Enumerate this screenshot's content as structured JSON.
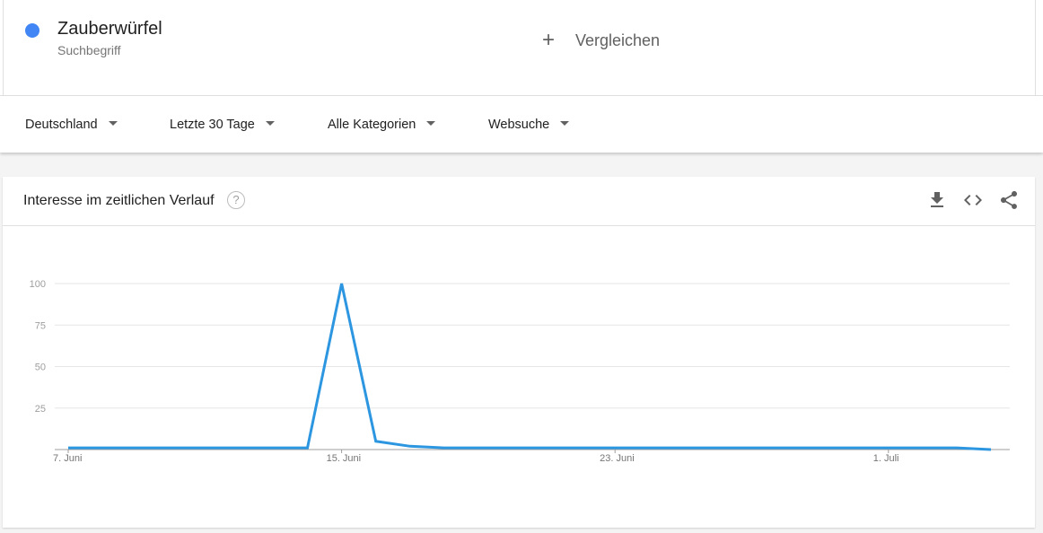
{
  "term": {
    "name": "Zauberwürfel",
    "type": "Suchbegriff",
    "color": "#4285f4"
  },
  "compare": {
    "plus": "+",
    "label": "Vergleichen"
  },
  "filters": {
    "region": "Deutschland",
    "time": "Letzte 30 Tage",
    "category": "Alle Kategorien",
    "search_type": "Websuche"
  },
  "card": {
    "title": "Interesse im zeitlichen Verlauf",
    "help": "?",
    "icons": [
      "download-icon",
      "embed-icon",
      "share-icon"
    ]
  },
  "chart_data": {
    "type": "line",
    "x": [
      "7. Juni",
      "8. Juni",
      "9. Juni",
      "10. Juni",
      "11. Juni",
      "12. Juni",
      "13. Juni",
      "14. Juni",
      "15. Juni",
      "16. Juni",
      "17. Juni",
      "18. Juni",
      "19. Juni",
      "20. Juni",
      "21. Juni",
      "22. Juni",
      "23. Juni",
      "24. Juni",
      "25. Juni",
      "26. Juni",
      "27. Juni",
      "28. Juni",
      "29. Juni",
      "30. Juni",
      "1. Juli",
      "2. Juli",
      "3. Juli",
      "4. Juli"
    ],
    "series": [
      {
        "name": "Zauberwürfel",
        "color": "#2d96e0",
        "values": [
          1,
          1,
          1,
          1,
          1,
          1,
          1,
          1,
          100,
          5,
          2,
          1,
          1,
          1,
          1,
          1,
          1,
          1,
          1,
          1,
          1,
          1,
          1,
          1,
          1,
          1,
          1,
          0
        ]
      }
    ],
    "x_ticks": [
      "7. Juni",
      "15. Juni",
      "23. Juni",
      "1. Juli"
    ],
    "yticks": [
      25,
      50,
      75,
      100
    ],
    "ylim": [
      0,
      100
    ],
    "grid": true
  }
}
